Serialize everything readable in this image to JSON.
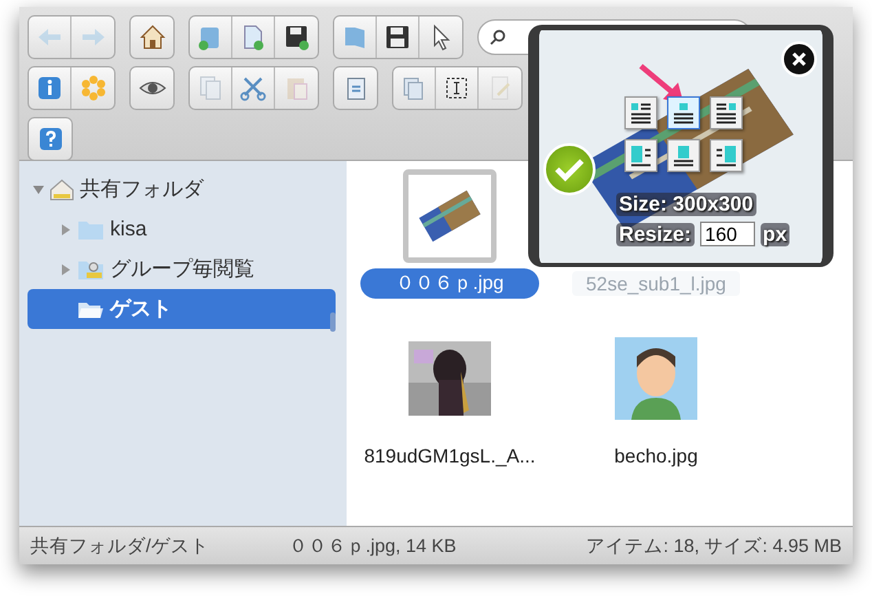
{
  "toolbar": {
    "rows": [
      [
        [
          {
            "kind": "back",
            "disabled": true
          },
          {
            "kind": "forward",
            "disabled": true
          }
        ],
        [
          {
            "kind": "home",
            "disabled": false
          }
        ],
        [
          {
            "kind": "new-folder",
            "disabled": false
          },
          {
            "kind": "new-file",
            "disabled": false
          },
          {
            "kind": "save-as",
            "disabled": false
          }
        ],
        [
          {
            "kind": "open",
            "disabled": false
          },
          {
            "kind": "save",
            "disabled": false
          },
          {
            "kind": "pointer",
            "disabled": false
          }
        ]
      ],
      [
        [
          {
            "kind": "info",
            "disabled": false
          },
          {
            "kind": "asterisk",
            "disabled": false
          }
        ],
        [
          {
            "kind": "view",
            "disabled": false
          }
        ],
        [
          {
            "kind": "copy",
            "disabled": true
          },
          {
            "kind": "cut",
            "disabled": false
          },
          {
            "kind": "paste",
            "disabled": true
          }
        ],
        [
          {
            "kind": "clipboard",
            "disabled": false
          }
        ],
        [
          {
            "kind": "duplicate",
            "disabled": false
          },
          {
            "kind": "select-box",
            "disabled": false
          },
          {
            "kind": "edit",
            "disabled": true
          }
        ]
      ],
      [
        [
          {
            "kind": "help",
            "disabled": false
          }
        ]
      ]
    ]
  },
  "sidebar": {
    "items": [
      {
        "label": "共有フォルダ",
        "kind": "shared",
        "expanded": true,
        "selected": false,
        "children": [
          {
            "label": "kisa",
            "kind": "folder",
            "expanded": false,
            "selected": false
          },
          {
            "label": "グループ毎閲覧",
            "kind": "shared",
            "expanded": false,
            "selected": false
          },
          {
            "label": "ゲスト",
            "kind": "open-folder",
            "selected": true
          }
        ]
      }
    ]
  },
  "files": [
    {
      "name": "００６ｐ.jpg",
      "selected": true,
      "kind": "battery"
    },
    {
      "name": "52se_sub1_l.jpg",
      "selected": false,
      "kind": "hidden"
    },
    {
      "name": "819udGM1gsL._A...",
      "selected": false
    },
    {
      "name": "becho.jpg",
      "selected": false,
      "kind": "avatar"
    }
  ],
  "popup": {
    "align_buttons": [
      {
        "kind": "text-left-image",
        "selected": false
      },
      {
        "kind": "text-center-image",
        "selected": true
      },
      {
        "kind": "text-right-image",
        "selected": false
      },
      {
        "kind": "image-left",
        "selected": false
      },
      {
        "kind": "image-center",
        "selected": false
      },
      {
        "kind": "image-right",
        "selected": false
      }
    ],
    "size_label": "Size: 300x300",
    "resize_label": "Resize:",
    "resize_value": "160",
    "unit": "px"
  },
  "status_bar": {
    "path": "共有フォルダ/ゲスト",
    "selection": "００６ｐ.jpg, 14 KB",
    "summary": "アイテム: 18, サイズ: 4.95 MB"
  }
}
